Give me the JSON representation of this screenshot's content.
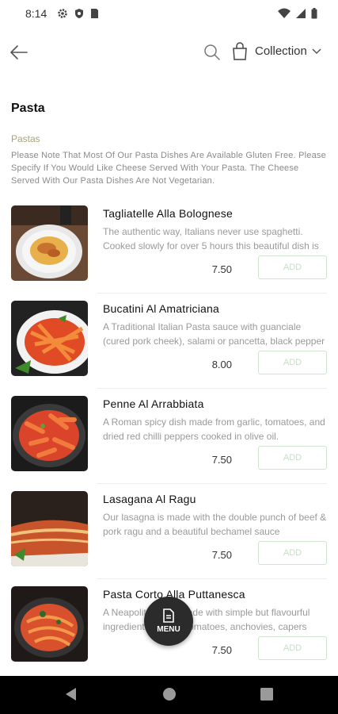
{
  "status_bar": {
    "time": "8:14"
  },
  "header": {
    "collection_label": "Collection"
  },
  "section": {
    "title": "Pasta",
    "subcategory": "Pastas",
    "note": "Please Note That Most Of Our Pasta Dishes Are Available Gluten Free. Please Specify If You Would Like Cheese Served With Your Pasta. The Cheese Served With Our Pasta Dishes Are Not Vegetarian."
  },
  "items": [
    {
      "name": "Tagliatelle Alla Bolognese",
      "description": "The authentic way, Italians never use spaghetti. Cooked slowly for over 5 hours this beautiful dish is",
      "price": "7.50",
      "add_label": "ADD"
    },
    {
      "name": "Bucatini Al Amatriciana",
      "description": "A Traditional Italian Pasta sauce with guanciale (cured pork cheek), salami or pancetta, black pepper",
      "price": "8.00",
      "add_label": "ADD"
    },
    {
      "name": "Penne Al Arrabbiata",
      "description": "A Roman spicy dish made from garlic, tomatoes, and dried red chilli peppers cooked in olive oil.",
      "price": "7.50",
      "add_label": "ADD"
    },
    {
      "name": "Lasagana Al Ragu",
      "description": "Our lasagna is made with the double punch of beef & pork ragu and a beautiful bechamel sauce",
      "price": "7.50",
      "add_label": "ADD"
    },
    {
      "name": "Pasta Corto Alla Puttanesca",
      "description": "A Neapolitan dish made with simple but flavourful ingredients: peeled tomatoes, anchovies, capers",
      "price": "7.50",
      "add_label": "ADD"
    }
  ],
  "fab": {
    "label": "MENU"
  },
  "colors": {
    "accent": "#a8a572",
    "add_border": "#cfe3cf",
    "fab_bg": "#2b2b2b"
  }
}
